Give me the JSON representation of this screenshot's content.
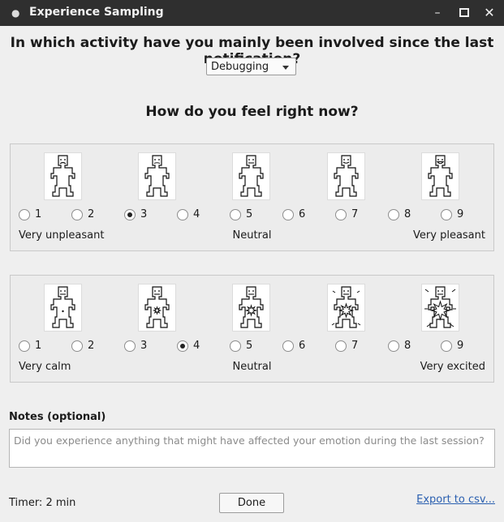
{
  "window": {
    "title": "Experience Sampling",
    "buttons": {
      "minimize": "–",
      "close": "✕"
    }
  },
  "activity": {
    "question": "In which activity have you mainly been involved since the last notification?",
    "selected": "Debugging"
  },
  "feel_question": "How do you feel right now?",
  "valence": {
    "selected_value": 3,
    "options": [
      "1",
      "2",
      "3",
      "4",
      "5",
      "6",
      "7",
      "8",
      "9"
    ],
    "labels": {
      "low": "Very unpleasant",
      "mid": "Neutral",
      "high": "Very pleasant"
    },
    "figures": [
      "frown-figure-icon",
      "sad-figure-icon",
      "neutral-figure-icon",
      "smile-figure-icon",
      "grin-figure-icon"
    ]
  },
  "arousal": {
    "selected_value": 4,
    "options": [
      "1",
      "2",
      "3",
      "4",
      "5",
      "6",
      "7",
      "8",
      "9"
    ],
    "labels": {
      "low": "Very calm",
      "mid": "Neutral",
      "high": "Very excited"
    },
    "figures": [
      "dot-figure-icon",
      "small-burst-figure-icon",
      "medium-burst-figure-icon",
      "large-burst-figure-icon",
      "explosion-figure-icon"
    ]
  },
  "notes": {
    "label": "Notes (optional)",
    "placeholder": "Did you experience anything that might have affected your emotion during the last session?"
  },
  "footer": {
    "timer": "Timer: 2 min",
    "done": "Done",
    "export": "Export to csv..."
  }
}
